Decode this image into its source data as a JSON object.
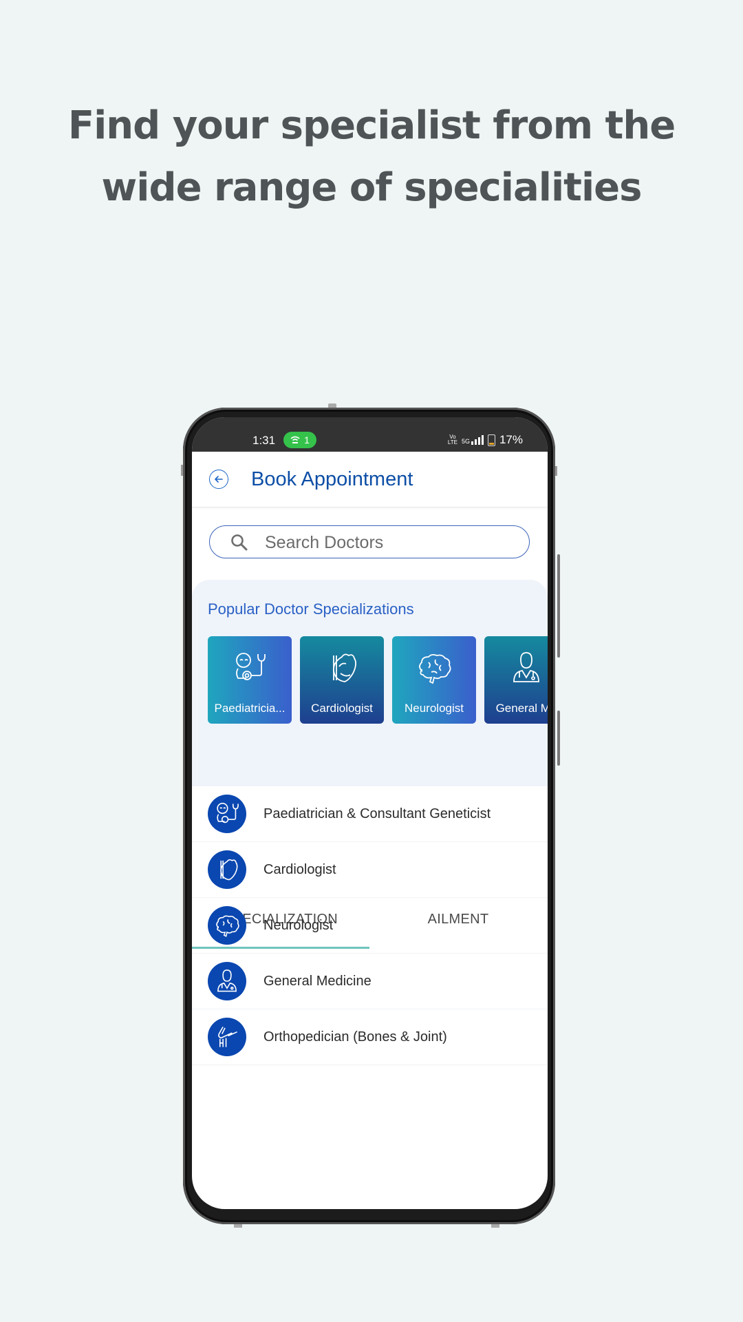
{
  "headline": {
    "line1": "Find your specialist from the",
    "line2": "wide range of specialities"
  },
  "status_bar": {
    "time": "1:31",
    "hotspot_count": "1",
    "volte": "Vo LTE",
    "network": "5G",
    "battery": "17%"
  },
  "app_bar": {
    "title": "Book Appointment",
    "back_icon": "arrow-left-circle-icon"
  },
  "search": {
    "placeholder": "Search Doctors",
    "value": ""
  },
  "popular": {
    "title": "Popular Doctor Specializations",
    "cards": [
      {
        "label": "Paediatricia...",
        "icon": "baby-stethoscope-icon"
      },
      {
        "label": "Cardiologist",
        "icon": "heart-icon"
      },
      {
        "label": "Neurologist",
        "icon": "brain-icon"
      },
      {
        "label": "General Me",
        "icon": "doctor-icon"
      }
    ]
  },
  "tabs": [
    {
      "label": "SPECIALIZATION",
      "active": true
    },
    {
      "label": "AILMENT",
      "active": false
    }
  ],
  "specializations": [
    {
      "label": "Paediatrician & Consultant Geneticist",
      "icon": "baby-stethoscope-icon"
    },
    {
      "label": "Cardiologist",
      "icon": "heart-icon"
    },
    {
      "label": "Neurologist",
      "icon": "brain-icon"
    },
    {
      "label": "General Medicine",
      "icon": "doctor-icon"
    },
    {
      "label": "Orthopedician (Bones & Joint)",
      "icon": "knee-joint-icon"
    }
  ],
  "colors": {
    "brand_blue": "#0d4ea6",
    "avatar_blue": "#0a47b0",
    "tab_indicator": "#6ec4bd",
    "background": "#eff4f4"
  }
}
